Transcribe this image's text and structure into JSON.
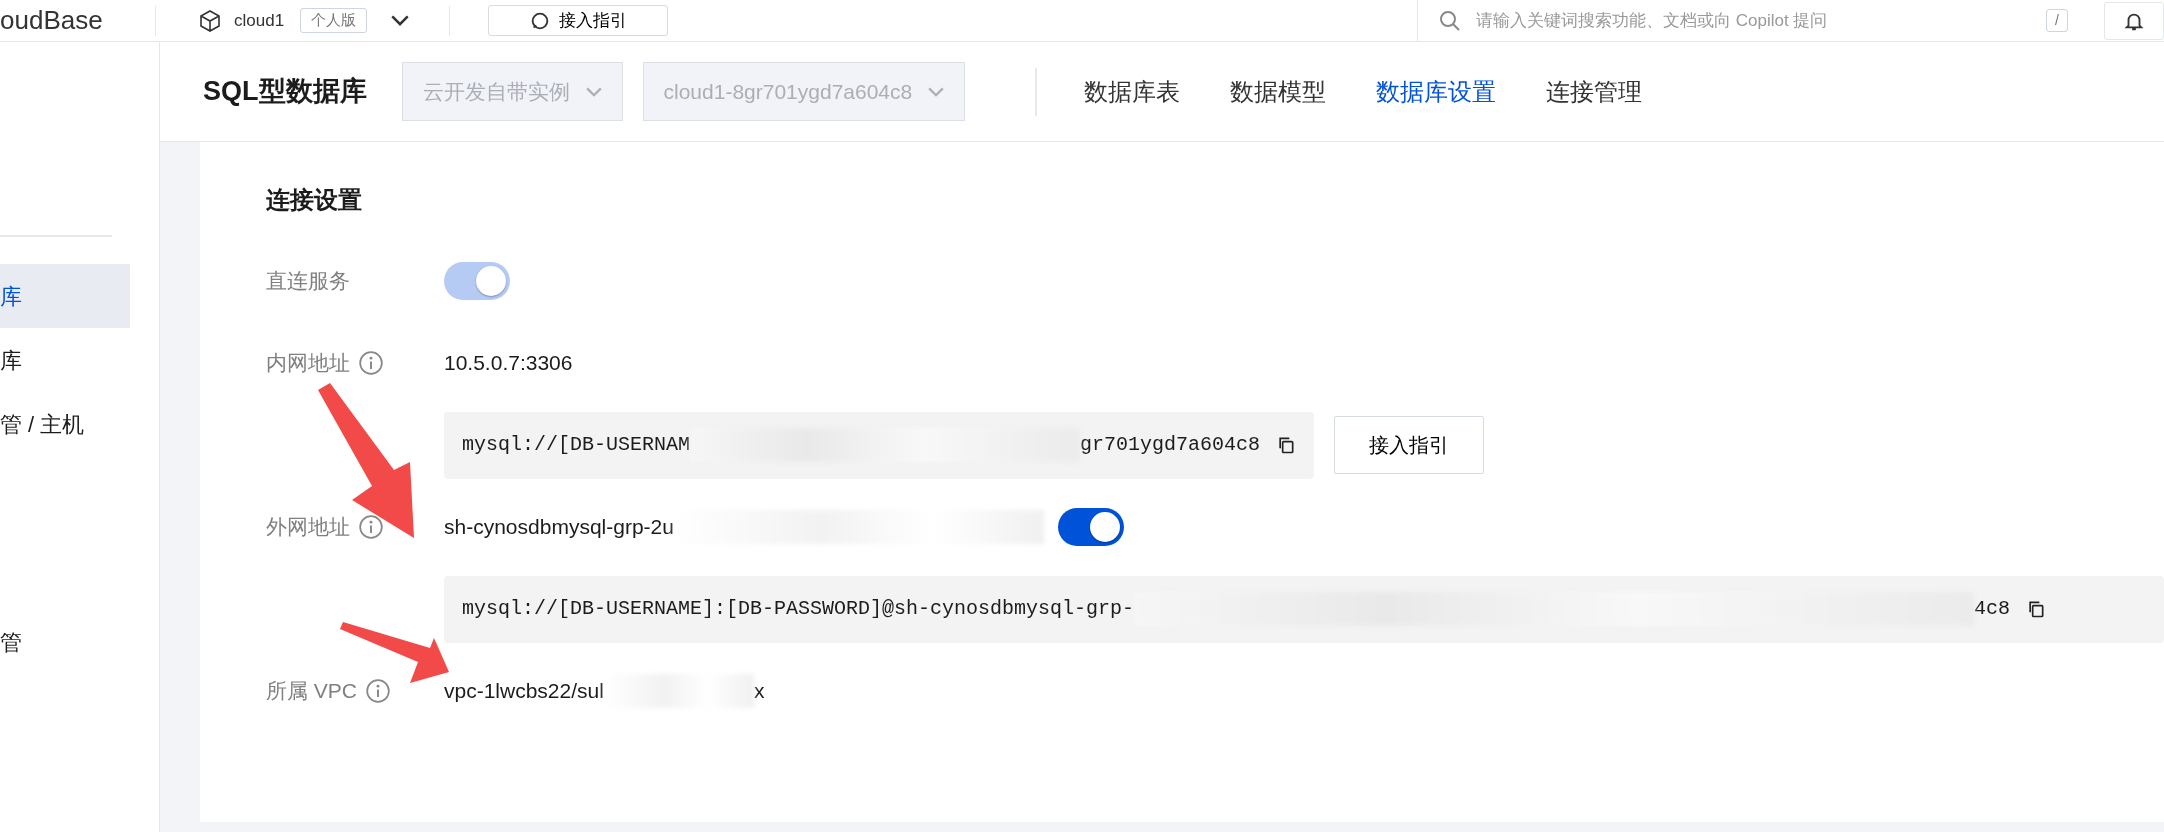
{
  "top_bar": {
    "brand": "oudBase",
    "env": "cloud1",
    "plan_badge": "个人版",
    "guide_button": "接入指引",
    "search": {
      "placeholder": "请输入关键词搜索功能、文档或向 Copilot 提问"
    },
    "shortcut_key": "/"
  },
  "sidebar": {
    "items": [
      {
        "label": "库",
        "selected": true
      },
      {
        "label": "库",
        "selected": false
      },
      {
        "label": "管 / 主机",
        "selected": false
      },
      {
        "label": "管",
        "selected": false
      }
    ]
  },
  "header": {
    "title": "SQL型数据库",
    "dropdowns": [
      {
        "value": "云开发自带实例",
        "disabled": true
      },
      {
        "value": "cloud1-8gr701ygd7a604c8",
        "disabled": true
      }
    ],
    "tabs": [
      {
        "label": "数据库表",
        "selected": false
      },
      {
        "label": "数据模型",
        "selected": false
      },
      {
        "label": "数据库设置",
        "selected": true
      },
      {
        "label": "连接管理",
        "selected": false
      }
    ]
  },
  "section": {
    "title": "连接设置",
    "rows": [
      {
        "kind": "toggle",
        "label": "直连服务",
        "toggle": {
          "on": true,
          "disabled": true
        }
      },
      {
        "kind": "text",
        "label": "内网地址",
        "value": "10.5.0.7:3306"
      },
      {
        "kind": "code",
        "text_start": "mysql://[DB-USERNAM",
        "text_end": "gr701ygd7a604c8",
        "button": "接入指引"
      },
      {
        "kind": "text_toggle",
        "label": "外网地址",
        "value": "sh-cynosdbmysql-grp-2u",
        "toggle": {
          "on": true,
          "disabled": false
        }
      },
      {
        "kind": "code",
        "text_start": "mysql://[DB-USERNAME]:[DB-PASSWORD]@sh-cynosdbmysql-grp-",
        "text_end": "4c8"
      },
      {
        "kind": "text",
        "label": "所属 VPC",
        "value": "vpc-1lwcbs22/sul",
        "value_end": "x"
      }
    ]
  }
}
